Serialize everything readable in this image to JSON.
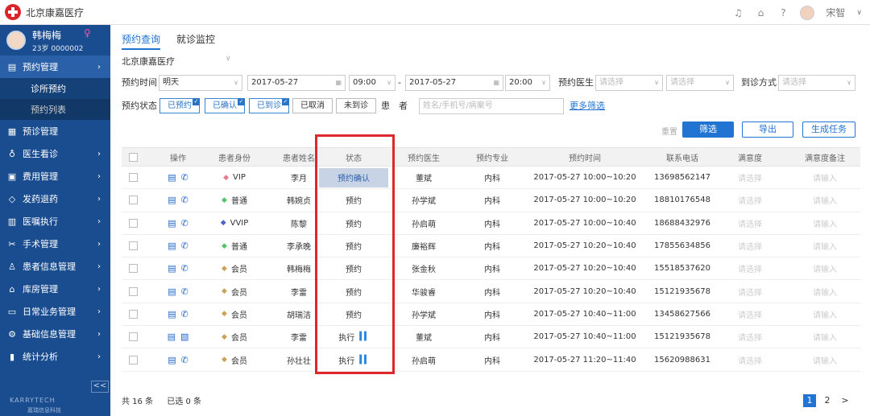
{
  "app": {
    "name": "北京康嘉医疗",
    "username": "宋智"
  },
  "user": {
    "name": "韩梅梅",
    "age": "23岁",
    "id": "0000002",
    "gender_icon": "♀"
  },
  "sidebar": {
    "items": [
      {
        "label": "预约管理",
        "icon": "calendar-icon"
      },
      {
        "label": "预诊管理",
        "icon": "doc-icon"
      },
      {
        "label": "医生看诊",
        "icon": "stethoscope-icon"
      },
      {
        "label": "费用管理",
        "icon": "money-icon"
      },
      {
        "label": "发药退药",
        "icon": "pill-icon"
      },
      {
        "label": "医嘱执行",
        "icon": "order-icon"
      },
      {
        "label": "手术管理",
        "icon": "scissors-icon"
      },
      {
        "label": "患者信息管理",
        "icon": "user-icon"
      },
      {
        "label": "库房管理",
        "icon": "home-icon"
      },
      {
        "label": "日常业务管理",
        "icon": "folder-icon"
      },
      {
        "label": "基础信息管理",
        "icon": "gear-icon"
      },
      {
        "label": "统计分析",
        "icon": "chart-icon"
      }
    ],
    "subitems": [
      "诊所预约",
      "预约列表"
    ],
    "collapse": "<<",
    "footer": "KARRYTECH",
    "footer2": "嘉瑞信息科技"
  },
  "tabs": [
    "预约查询",
    "就诊监控"
  ],
  "filters": {
    "org": "北京康嘉医疗",
    "time_label": "预约时间",
    "time_value": "明天",
    "date_start": "2017-05-27",
    "time_start": "09:00",
    "dash": "-",
    "date_end": "2017-05-27",
    "time_end": "20:00",
    "doctor_label": "预约医生",
    "select_placeholder": "请选择",
    "method_label": "到诊方式",
    "status_label": "预约状态",
    "status_chips": [
      "已预约",
      "已确认",
      "已到诊",
      "已取消",
      "未到诊"
    ],
    "patient_label": "患　者",
    "patient_placeholder": "姓名/手机号/病案号",
    "more": "更多筛选"
  },
  "actions": {
    "reset": "重置",
    "filter": "筛选",
    "export": "导出",
    "generate": "生成任务"
  },
  "table": {
    "headers": [
      "操作",
      "患者身份",
      "患者姓名",
      "状态",
      "预约医生",
      "预约专业",
      "预约时间",
      "联系电话",
      "满意度",
      "满意度备注"
    ],
    "rows": [
      {
        "identity": "VIP",
        "diamond": "#e87b8b",
        "name": "李月",
        "status": "预约确认",
        "doctor": "董斌",
        "dept": "内科",
        "time": "2017-05-27 10:00~10:20",
        "phone": "13698562147"
      },
      {
        "identity": "普通",
        "diamond": "#53c46a",
        "name": "韩婉贞",
        "status": "预约",
        "doctor": "孙学斌",
        "dept": "内科",
        "time": "2017-05-27 10:00~10:20",
        "phone": "18810176548"
      },
      {
        "identity": "VVIP",
        "diamond": "#4a63c8",
        "name": "陈黎",
        "status": "预约",
        "doctor": "孙启萌",
        "dept": "内科",
        "time": "2017-05-27 10:00~10:40",
        "phone": "18688432976"
      },
      {
        "identity": "普通",
        "diamond": "#53c46a",
        "name": "李承晚",
        "status": "预约",
        "doctor": "廉裕辉",
        "dept": "内科",
        "time": "2017-05-27 10:20~10:40",
        "phone": "17855634856"
      },
      {
        "identity": "会员",
        "diamond": "#c9a25a",
        "name": "韩梅梅",
        "status": "预约",
        "doctor": "张金秋",
        "dept": "内科",
        "time": "2017-05-27 10:20~10:40",
        "phone": "15518537620"
      },
      {
        "identity": "会员",
        "diamond": "#c9a25a",
        "name": "李雷",
        "status": "预约",
        "doctor": "华骏睿",
        "dept": "内科",
        "time": "2017-05-27 10:20~10:40",
        "phone": "15121935678"
      },
      {
        "identity": "会员",
        "diamond": "#c9a25a",
        "name": "胡瑞洁",
        "status": "预约",
        "doctor": "孙学斌",
        "dept": "内科",
        "time": "2017-05-27 10:40~11:00",
        "phone": "13458627566"
      },
      {
        "identity": "会员",
        "diamond": "#c9a25a",
        "name": "李雷",
        "status": "执行",
        "doctor": "董斌",
        "dept": "内科",
        "time": "2017-05-27 10:40~11:00",
        "phone": "15121935678"
      },
      {
        "identity": "会员",
        "diamond": "#c9a25a",
        "name": "孙壮壮",
        "status": "执行",
        "doctor": "孙启萌",
        "dept": "内科",
        "time": "2017-05-27 11:20~11:40",
        "phone": "15620988631"
      }
    ],
    "select_placeholder": "请选择",
    "input_placeholder": "请输入"
  },
  "footer": {
    "total": "共 16 条",
    "selected": "已选 0 条"
  },
  "pager": {
    "pages": [
      "1",
      "2"
    ],
    "next": ">"
  },
  "colors": {
    "sidebar": "#1a4d8f",
    "accent": "#2274d2",
    "highlight": "#e0262d"
  }
}
